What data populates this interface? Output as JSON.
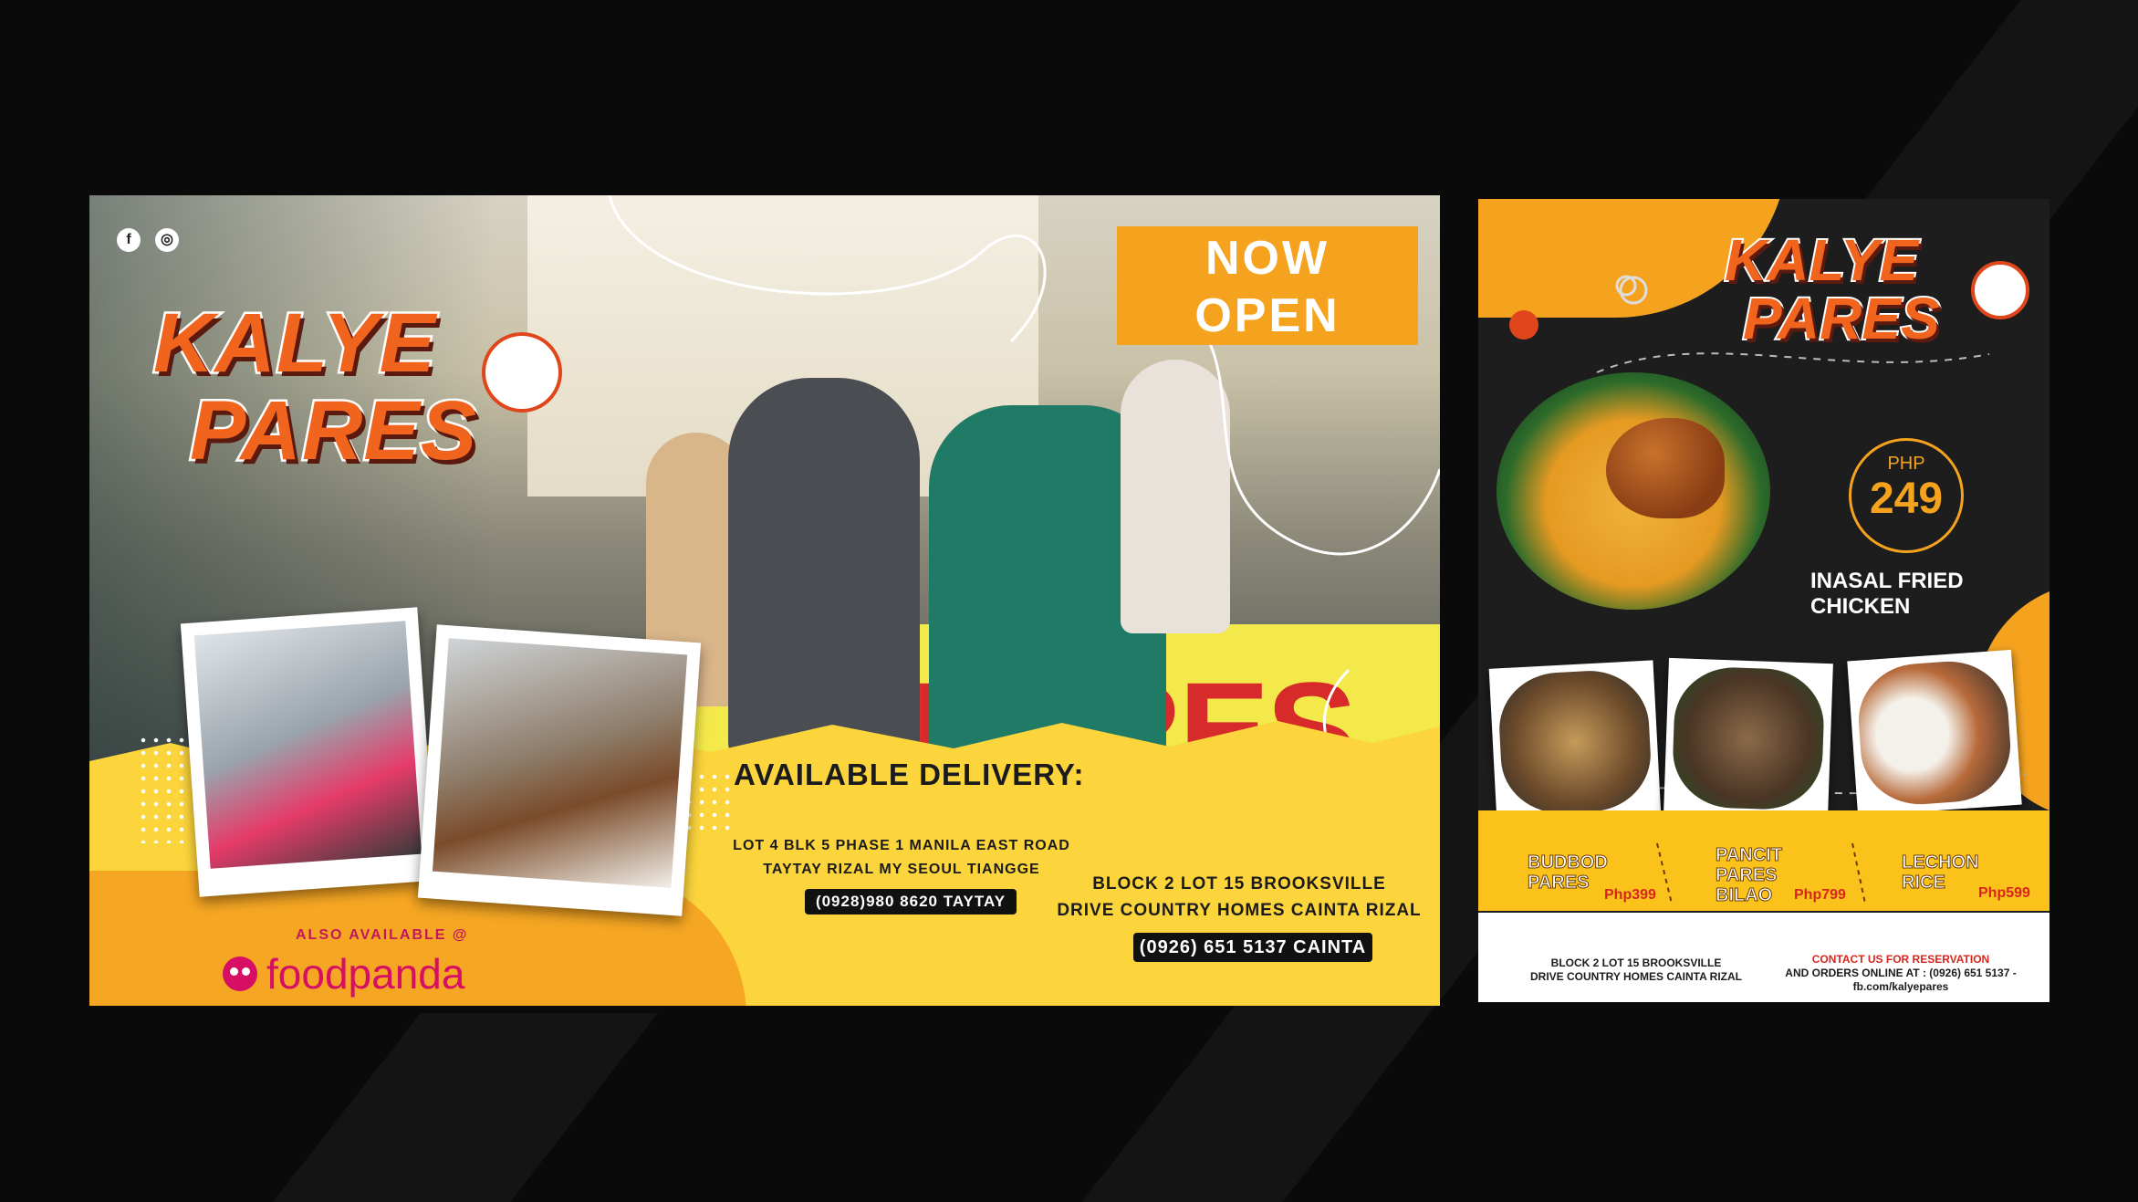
{
  "banner": {
    "social": {
      "facebook": "f",
      "instagram": "◎"
    },
    "logo": {
      "line1": "KALYE",
      "line2": "PARES"
    },
    "now_open": {
      "line1": "NOW",
      "line2": "OPEN"
    },
    "counter_text": "PARES",
    "delivery_title": "AVAILABLE DELIVERY:",
    "branch1": {
      "line1": "LOT 4 BLK 5 PHASE 1 MANILA EAST ROAD",
      "line2": "TAYTAY RIZAL MY SEOUL TIANGGE",
      "phone": "(0928)980 8620 TAYTAY"
    },
    "branch2": {
      "line1": "BLOCK 2 LOT 15 BROOKSVILLE",
      "line2": "DRIVE COUNTRY HOMES CAINTA RIZAL",
      "phone": "(0926) 651 5137 CAINTA"
    },
    "also_available": "ALSO  AVAILABLE @",
    "foodpanda": "foodpanda"
  },
  "poster": {
    "logo": {
      "line1": "KALYE",
      "line2": "PARES"
    },
    "price_label": "PHP",
    "price_value": "249",
    "dish_title": "INASAL FRIED CHICKEN",
    "menu": [
      {
        "name_l1": "BUDBOD",
        "name_l2": "PARES",
        "name_l3": "",
        "price": "Php399"
      },
      {
        "name_l1": "PANCIT",
        "name_l2": "PARES",
        "name_l3": "BILAO",
        "price": "Php799"
      },
      {
        "name_l1": "LECHON",
        "name_l2": "RICE",
        "name_l3": "",
        "price": "Php599"
      }
    ],
    "address": {
      "line1": "BLOCK 2 LOT 15 BROOKSVILLE",
      "line2": "DRIVE COUNTRY HOMES CAINTA RIZAL"
    },
    "contact": {
      "title": "CONTACT US FOR RESERVATION",
      "line1": "AND ORDERS ONLINE AT : (0926) 651 5137 -",
      "line2": "fb.com/kalyepares"
    }
  },
  "colors": {
    "background": "#0a0a0a",
    "brand_orange": "#f5a31f",
    "brand_yellow": "#fcd43c",
    "logo_red_orange": "#f0641e",
    "foodpanda_pink": "#d70f64"
  }
}
